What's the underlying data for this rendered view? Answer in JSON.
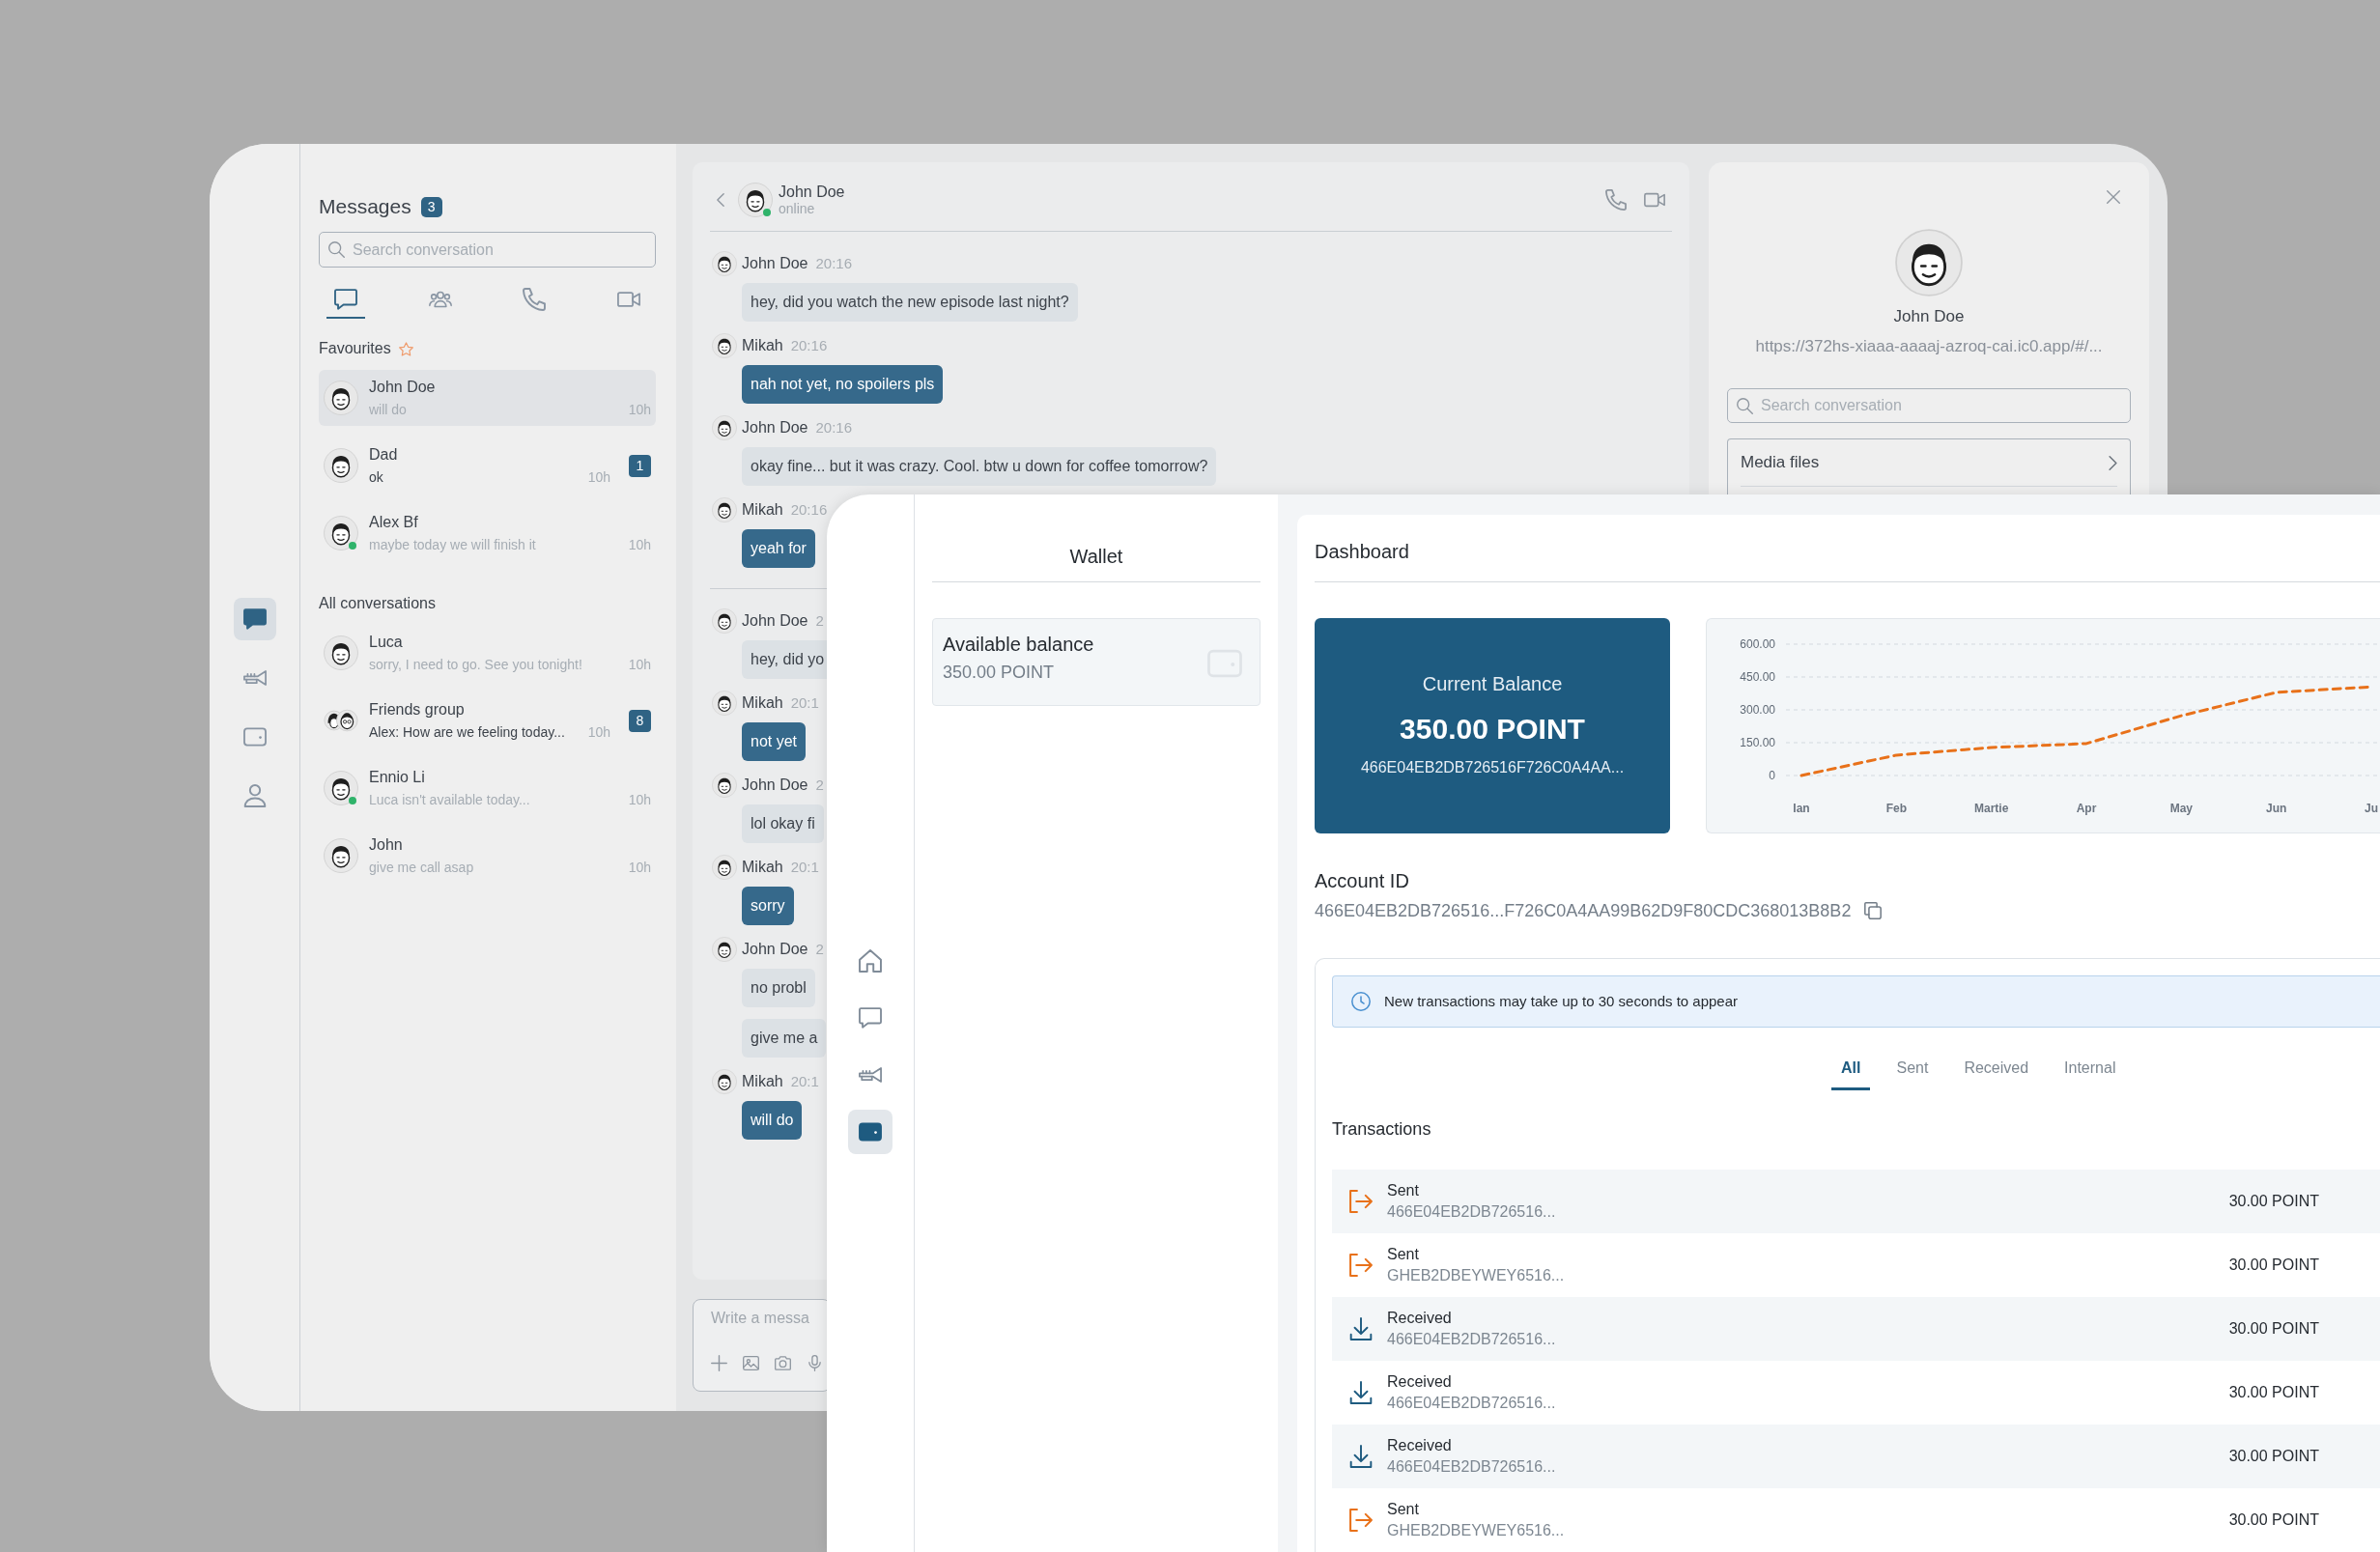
{
  "back_window": {
    "rail": [
      {
        "kind": "chat",
        "selected": true
      },
      {
        "kind": "trumpet",
        "selected": false
      },
      {
        "kind": "wallet",
        "selected": false
      },
      {
        "kind": "user",
        "selected": false
      }
    ],
    "messages": {
      "title": "Messages",
      "count": "3",
      "search": {
        "placeholder": "Search conversation"
      },
      "tabs": [
        {
          "kind": "chat",
          "selected": true
        },
        {
          "kind": "group",
          "selected": false
        },
        {
          "kind": "phone",
          "selected": false
        },
        {
          "kind": "video",
          "selected": false
        }
      ],
      "sections": [
        {
          "title": "Favourites",
          "starred": true,
          "conversations": [
            {
              "kind": "person",
              "name": "John Doe",
              "preview": "will do",
              "time": "10h",
              "online": false,
              "selected": true
            },
            {
              "kind": "person",
              "name": "Dad",
              "preview": "ok",
              "time": "10h",
              "unread": "1",
              "online": false,
              "selected": false
            },
            {
              "kind": "person",
              "name": "Alex Bf",
              "preview": "maybe today we will finish it",
              "time": "10h",
              "online": true,
              "selected": false
            }
          ]
        },
        {
          "title": "All conversations",
          "starred": false,
          "conversations": [
            {
              "kind": "person",
              "name": "Luca",
              "preview": "sorry, I need to go. See you tonight!",
              "time": "10h",
              "online": false,
              "selected": false
            },
            {
              "kind": "group",
              "name": "Friends group",
              "preview": "Alex: How are we feeling today...",
              "time": "10h",
              "unread": "8",
              "online": false,
              "selected": false
            },
            {
              "kind": "person",
              "name": "Ennio Li",
              "preview": "Luca isn't available today...",
              "time": "10h",
              "online": true,
              "selected": false
            },
            {
              "kind": "person",
              "name": "John",
              "preview": "give me call asap",
              "time": "10h",
              "online": false,
              "selected": false
            }
          ]
        }
      ]
    },
    "chat": {
      "contact": {
        "name": "John Doe",
        "status": "online",
        "online": true
      },
      "messages": [
        {
          "kind": "incoming",
          "sender": "John Doe",
          "time": "20:16",
          "bubbles": [
            "hey, did you watch the new episode last night?"
          ]
        },
        {
          "kind": "outgoing",
          "sender": "Mikah",
          "time": "20:16",
          "bubbles": [
            "nah not yet, no spoilers pls"
          ]
        },
        {
          "kind": "incoming",
          "sender": "John Doe",
          "time": "20:16",
          "bubbles": [
            "okay fine... but it was crazy. Cool. btw u down for coffee tomorrow?"
          ]
        },
        {
          "kind": "outgoing",
          "sender": "Mikah",
          "time": "20:16",
          "bubbles": [
            "yeah for"
          ]
        },
        {
          "kind": "divider"
        },
        {
          "kind": "incoming",
          "sender": "John Doe",
          "time": "2",
          "bubbles": [
            "hey, did yo"
          ]
        },
        {
          "kind": "outgoing",
          "sender": "Mikah",
          "time": "20:1",
          "bubbles": [
            "not yet"
          ]
        },
        {
          "kind": "incoming",
          "sender": "John Doe",
          "time": "2",
          "bubbles": [
            "lol okay fi"
          ]
        },
        {
          "kind": "outgoing",
          "sender": "Mikah",
          "time": "20:1",
          "bubbles": [
            "sorry"
          ]
        },
        {
          "kind": "incoming",
          "sender": "John Doe",
          "time": "2",
          "bubbles": [
            "no probl",
            "give me a"
          ]
        },
        {
          "kind": "outgoing",
          "sender": "Mikah",
          "time": "20:1",
          "bubbles": [
            "will do"
          ]
        }
      ],
      "composer": {
        "placeholder": "Write a messa"
      }
    },
    "profile": {
      "name": "John Doe",
      "link": "https://372hs-xiaaa-aaaaj-azroq-cai.ic0.app/#/...",
      "search": {
        "placeholder": "Search conversation"
      },
      "items": [
        {
          "label": "Media files"
        }
      ]
    }
  },
  "front_window": {
    "rail": [
      {
        "kind": "home",
        "selected": false
      },
      {
        "kind": "chat",
        "selected": false
      },
      {
        "kind": "trumpet",
        "selected": false
      },
      {
        "kind": "wallet",
        "selected": true
      }
    ],
    "wallet": {
      "title": "Wallet",
      "balance": {
        "label": "Available balance",
        "amount": "350.00 POINT"
      }
    },
    "dashboard": {
      "title": "Dashboard",
      "balance": {
        "label": "Current Balance",
        "amount": "350.00 POINT",
        "address": "466E04EB2DB726516F726C0A4AA..."
      },
      "chart_data": {
        "type": "line",
        "grid": true,
        "categories": [
          "Ian",
          "Feb",
          "Martie",
          "Apr",
          "May",
          "Jun",
          "Ju"
        ],
        "series": [
          {
            "color": "#e8711a",
            "line_style": "dashed",
            "values": [
              0,
              93,
              128,
              146,
              273,
              380,
              405
            ]
          }
        ],
        "ylim": [
          0,
          600
        ],
        "yticks": [
          0,
          {
            "value": 150,
            "label": "150.00"
          },
          {
            "value": 300,
            "label": "300.00"
          },
          {
            "value": 450,
            "label": "450.00"
          },
          {
            "value": 600,
            "label": "600.00"
          }
        ]
      },
      "account": {
        "label": "Account ID",
        "id": "466E04EB2DB726516...F726C0A4AA99B62D9F80CDC368013B8B2"
      },
      "notice": "New transactions may take up to 30 seconds to appear",
      "tabs": [
        {
          "label": "All",
          "selected": true
        },
        {
          "label": "Sent",
          "selected": false
        },
        {
          "label": "Received",
          "selected": false
        },
        {
          "label": "Internal",
          "selected": false
        }
      ],
      "transactions": {
        "title": "Transactions",
        "rows": [
          {
            "kind": "sent",
            "type": "Sent",
            "address": "466E04EB2DB726516...",
            "amount": "30.00 POINT"
          },
          {
            "kind": "sent",
            "type": "Sent",
            "address": "GHEB2DBEYWEY6516...",
            "amount": "30.00 POINT"
          },
          {
            "kind": "received",
            "type": "Received",
            "address": "466E04EB2DB726516...",
            "amount": "30.00 POINT"
          },
          {
            "kind": "received",
            "type": "Received",
            "address": "466E04EB2DB726516...",
            "amount": "30.00 POINT"
          },
          {
            "kind": "received",
            "type": "Received",
            "address": "466E04EB2DB726516...",
            "amount": "30.00 POINT"
          },
          {
            "kind": "sent",
            "type": "Sent",
            "address": "GHEB2DBEYWEY6516...",
            "amount": "30.00 POINT"
          }
        ]
      }
    }
  }
}
